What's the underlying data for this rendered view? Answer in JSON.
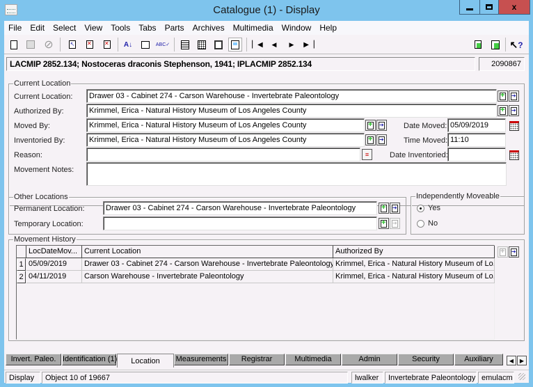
{
  "window": {
    "title": "Catalogue (1) - Display",
    "minimize": "_",
    "maximize": "□",
    "close": "x"
  },
  "menu": [
    "File",
    "Edit",
    "Select",
    "View",
    "Tools",
    "Tabs",
    "Parts",
    "Archives",
    "Multimedia",
    "Window",
    "Help"
  ],
  "toolbar": {
    "icons": {
      "new": "🗋",
      "save": "💾",
      "cancel": "⊘",
      "first_rec": "⏮",
      "prev": "◀",
      "next": "▶",
      "last": "⏭",
      "help": "?"
    }
  },
  "record": {
    "summary": "LACMIP 2852.134; Nostoceras draconis Stephenson, 1941; IPLACMIP 2852.134",
    "irn": "2090867"
  },
  "current_location": {
    "legend": "Current Location",
    "labels": {
      "current_location": "Current Location:",
      "authorized_by": "Authorized By:",
      "moved_by": "Moved By:",
      "inventoried_by": "Inventoried By:",
      "reason": "Reason:",
      "movement_notes": "Movement Notes:",
      "date_moved": "Date Moved:",
      "time_moved": "Time Moved:",
      "date_inventoried": "Date Inventoried:"
    },
    "values": {
      "current_location": "Drawer 03 - Cabinet 274 - Carson Warehouse - Invertebrate Paleontology",
      "authorized_by": "Krimmel, Erica - Natural History Museum of Los Angeles County",
      "moved_by": "Krimmel, Erica - Natural History Museum of Los Angeles County",
      "inventoried_by": "Krimmel, Erica - Natural History Museum of Los Angeles County",
      "reason": "",
      "movement_notes": "",
      "date_moved": "05/09/2019",
      "time_moved": "11:10",
      "date_inventoried": ""
    }
  },
  "other_locations": {
    "legend": "Other Locations",
    "labels": {
      "permanent_location": "Permanent Location:",
      "temporary_location": "Temporary Location:"
    },
    "values": {
      "permanent_location": "Drawer 03 - Cabinet 274 - Carson Warehouse - Invertebrate Paleontology",
      "temporary_location": ""
    }
  },
  "independently_moveable": {
    "legend": "Independently Moveable",
    "options": [
      "Yes",
      "No"
    ],
    "selected": "Yes"
  },
  "movement_history": {
    "legend": "Movement History",
    "columns": [
      "LocDateMov...",
      "Current Location",
      "Authorized By"
    ],
    "rows": [
      {
        "num": "1",
        "date": "05/09/2019",
        "location": "Drawer 03 - Cabinet 274 - Carson Warehouse - Invertebrate Paleontology",
        "authorized": "Krimmel, Erica - Natural History Museum of Lo..."
      },
      {
        "num": "2",
        "date": "04/11/2019",
        "location": "Carson Warehouse - Invertebrate Paleontology",
        "authorized": "Krimmel, Erica - Natural History Museum of Lo..."
      }
    ]
  },
  "tabs": [
    {
      "label": "Invert. Paleo."
    },
    {
      "label": "Identification (1)"
    },
    {
      "label": "Location",
      "active": true
    },
    {
      "label": "Measurements"
    },
    {
      "label": "Registrar"
    },
    {
      "label": "Multimedia"
    },
    {
      "label": "Admin"
    },
    {
      "label": "Security"
    },
    {
      "label": "Auxiliary"
    }
  ],
  "status": {
    "mode": "Display",
    "position": "Object 10 of 19667",
    "user": "lwalker",
    "group": "Invertebrate Paleontology",
    "database": "emulacm"
  }
}
